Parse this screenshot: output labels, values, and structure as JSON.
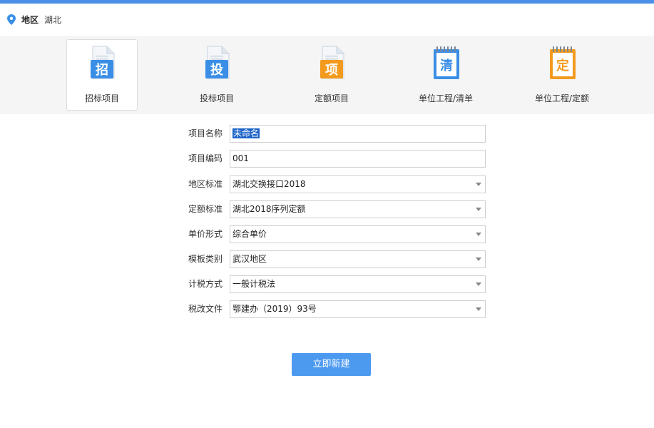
{
  "region": {
    "label": "地区",
    "value": "湖北"
  },
  "project_types": [
    {
      "icon_char": "招",
      "label": "招标项目",
      "color": "#3a8ee6",
      "shape": "doc",
      "active": true
    },
    {
      "icon_char": "投",
      "label": "投标项目",
      "color": "#3a8ee6",
      "shape": "doc",
      "active": false
    },
    {
      "icon_char": "项",
      "label": "定额项目",
      "color": "#f39a1e",
      "shape": "doc",
      "active": false
    },
    {
      "icon_char": "清",
      "label": "单位工程/清单",
      "color": "#3a8ee6",
      "shape": "pad",
      "active": false
    },
    {
      "icon_char": "定",
      "label": "单位工程/定额",
      "color": "#f39a1e",
      "shape": "pad",
      "active": false
    }
  ],
  "form": {
    "project_name": {
      "label": "项目名称",
      "value": "未命名"
    },
    "project_code": {
      "label": "项目编码",
      "value": "001"
    },
    "region_standard": {
      "label": "地区标准",
      "value": "湖北交换接口2018"
    },
    "quota_standard": {
      "label": "定额标准",
      "value": "湖北2018序列定额"
    },
    "unit_price_form": {
      "label": "单价形式",
      "value": "综合单价"
    },
    "template_category": {
      "label": "模板类别",
      "value": "武汉地区"
    },
    "tax_method": {
      "label": "计税方式",
      "value": "一般计税法"
    },
    "tax_reform_doc": {
      "label": "税改文件",
      "value": "鄂建办（2019）93号"
    }
  },
  "submit_label": "立即新建",
  "colors": {
    "accent": "#4a90e8",
    "button": "#4c9af0",
    "strip_bg": "#f5f5f5"
  }
}
